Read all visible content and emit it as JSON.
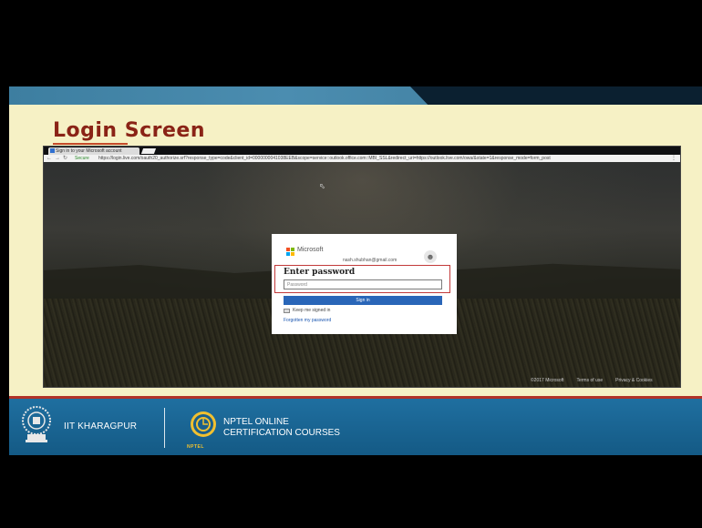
{
  "slide": {
    "title": "Login Screen"
  },
  "browser": {
    "tab_title": "Sign in to your Microsoft account",
    "secure_label": "Secure",
    "url": "https://login.live.com/oauth20_authorize.srf?response_type=code&client_id=0000000041038EEB&scope=service::outlook.office.com::MBI_SSL&redirect_uri=https://outlook.live.com/owa/&state=1&response_mode=form_post",
    "footer_copyright": "©2017 Microsoft",
    "footer_terms": "Terms of use",
    "footer_privacy": "Privacy & Cookies"
  },
  "login": {
    "brand": "Microsoft",
    "account_email": "nash.shubhan@gmail.com",
    "heading": "Enter password",
    "password_placeholder": "Password",
    "password_value": "",
    "signin_label": "Sign in",
    "keep_signed_in_label": "Keep me signed in",
    "keep_signed_in_checked": false,
    "forgot_label": "Forgotten my password"
  },
  "footer": {
    "iit_label": "IIT KHARAGPUR",
    "nptel_line1": "NPTEL ONLINE",
    "nptel_line2": "CERTIFICATION COURSES",
    "nptel_small": "NPTEL"
  },
  "icons": {
    "account": "person-icon",
    "cursor": "mouse-pointer-icon",
    "tab_favicon": "microsoft-logo-icon"
  },
  "colors": {
    "slide_bg": "#f6f1c5",
    "title": "#8a2316",
    "band_blue": "#1f6fa0",
    "signin_blue": "#2a66b8",
    "highlight_red": "#c23a3a"
  }
}
